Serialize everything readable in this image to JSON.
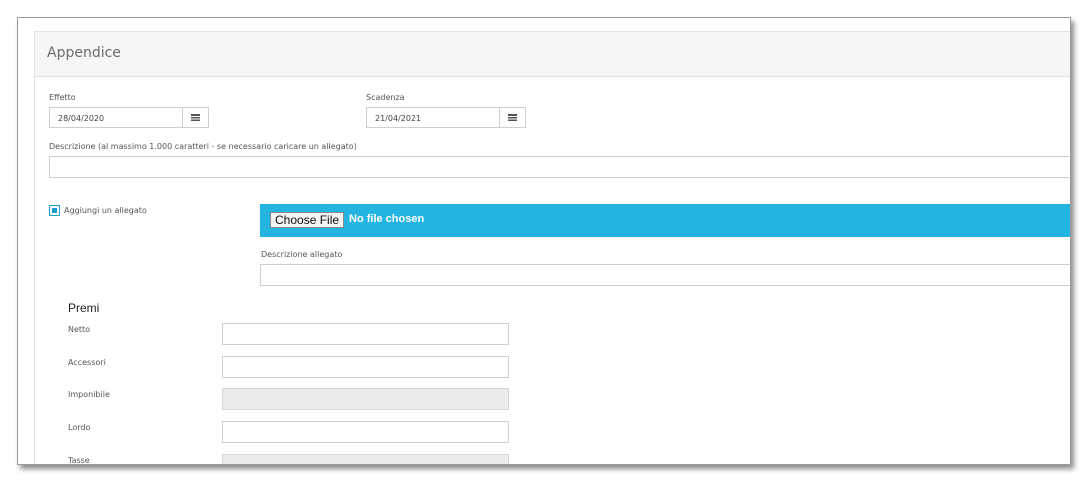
{
  "header": {
    "title": "Appendice"
  },
  "effetto": {
    "label": "Effetto",
    "value": "28/04/2020"
  },
  "scadenza": {
    "label": "Scadenza",
    "value": "21/04/2021"
  },
  "descrizione": {
    "label": "Descrizione (al massimo 1.000 caratteri - se necessario caricare un allegato)",
    "value": ""
  },
  "allegato": {
    "checkbox_label": "Aggiungi un allegato",
    "checked": true,
    "choose_button": "Choose File",
    "file_status": "No file chosen",
    "descrizione_label": "Descrizione allegato",
    "descrizione_value": ""
  },
  "premi": {
    "title": "Premi",
    "fields": [
      {
        "label": "Netto",
        "value": "",
        "disabled": false
      },
      {
        "label": "Accessori",
        "value": "",
        "disabled": false
      },
      {
        "label": "Imponibile",
        "value": "",
        "disabled": true
      },
      {
        "label": "Lordo",
        "value": "",
        "disabled": false
      },
      {
        "label": "Tasse",
        "value": "",
        "disabled": true
      }
    ]
  },
  "colors": {
    "accent": "#23b4e1",
    "header_bg": "#f5f6f5",
    "disabled_bg": "#ececec"
  },
  "icons": {
    "calendar": "calendar-icon"
  }
}
